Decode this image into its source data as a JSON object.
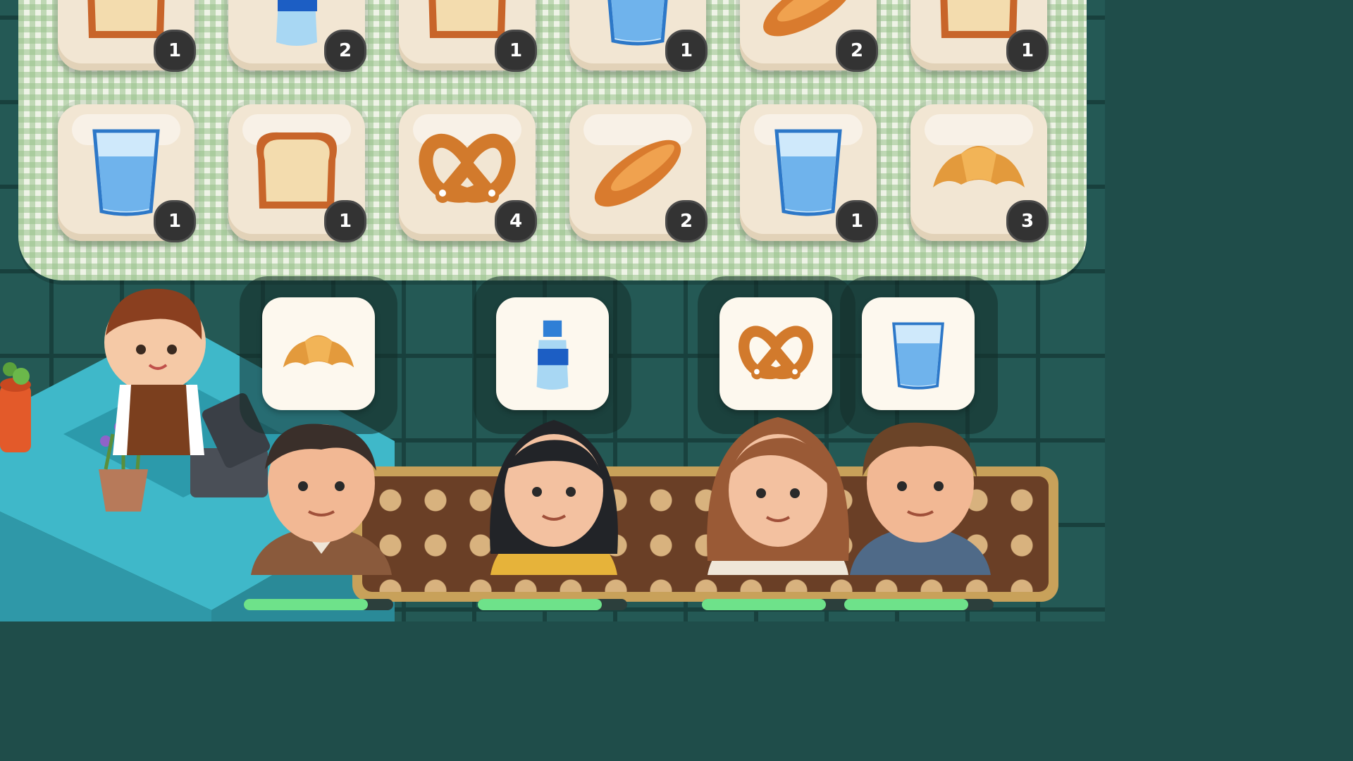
{
  "board": {
    "rows": [
      [
        {
          "item": "toast-bread",
          "count": "1"
        },
        {
          "item": "water-bottle",
          "count": "2"
        },
        {
          "item": "toast-bread",
          "count": "1"
        },
        {
          "item": "water-glass",
          "count": "1"
        },
        {
          "item": "baguette",
          "count": "2"
        },
        {
          "item": "toast-bread",
          "count": "1"
        }
      ],
      [
        {
          "item": "water-glass",
          "count": "1"
        },
        {
          "item": "toast-bread",
          "count": "1"
        },
        {
          "item": "pretzel",
          "count": "4"
        },
        {
          "item": "baguette",
          "count": "2"
        },
        {
          "item": "water-glass",
          "count": "1"
        },
        {
          "item": "croissant",
          "count": "3"
        }
      ]
    ]
  },
  "orders": [
    {
      "item": "croissant",
      "customer": "man-brown-shirt",
      "patience": 0.83
    },
    {
      "item": "water-bottle",
      "customer": "woman-black-hair",
      "patience": 0.83
    },
    {
      "item": "pretzel",
      "customer": "woman-brown-hair",
      "patience": 0.83
    },
    {
      "item": "water-glass",
      "customer": "man-blue-shirt",
      "patience": 0.83
    }
  ],
  "colors": {
    "tray": "#eef3e6",
    "tile": "#f2e6d3",
    "badge": "#333333",
    "patience": "#6ee28a",
    "counter": "#3fb8c9",
    "belt": "#6a3f26"
  }
}
